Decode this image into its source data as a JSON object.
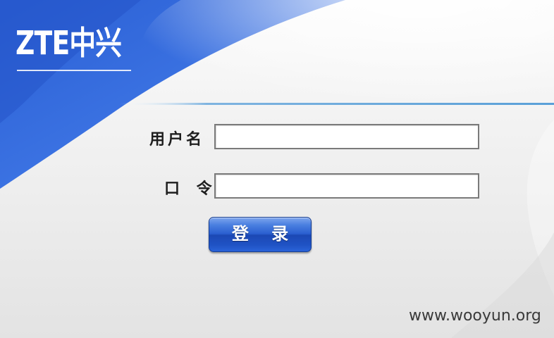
{
  "brand": {
    "logo_text": "ZTE中兴",
    "blue": "#2f63d6",
    "dark_blue": "#1b46b0"
  },
  "form": {
    "username_label": "用户名",
    "username_value": "",
    "password_label": "口 令",
    "password_value": "",
    "login_label": "登 录"
  },
  "footer": {
    "watermark": "www.wooyun.org"
  }
}
